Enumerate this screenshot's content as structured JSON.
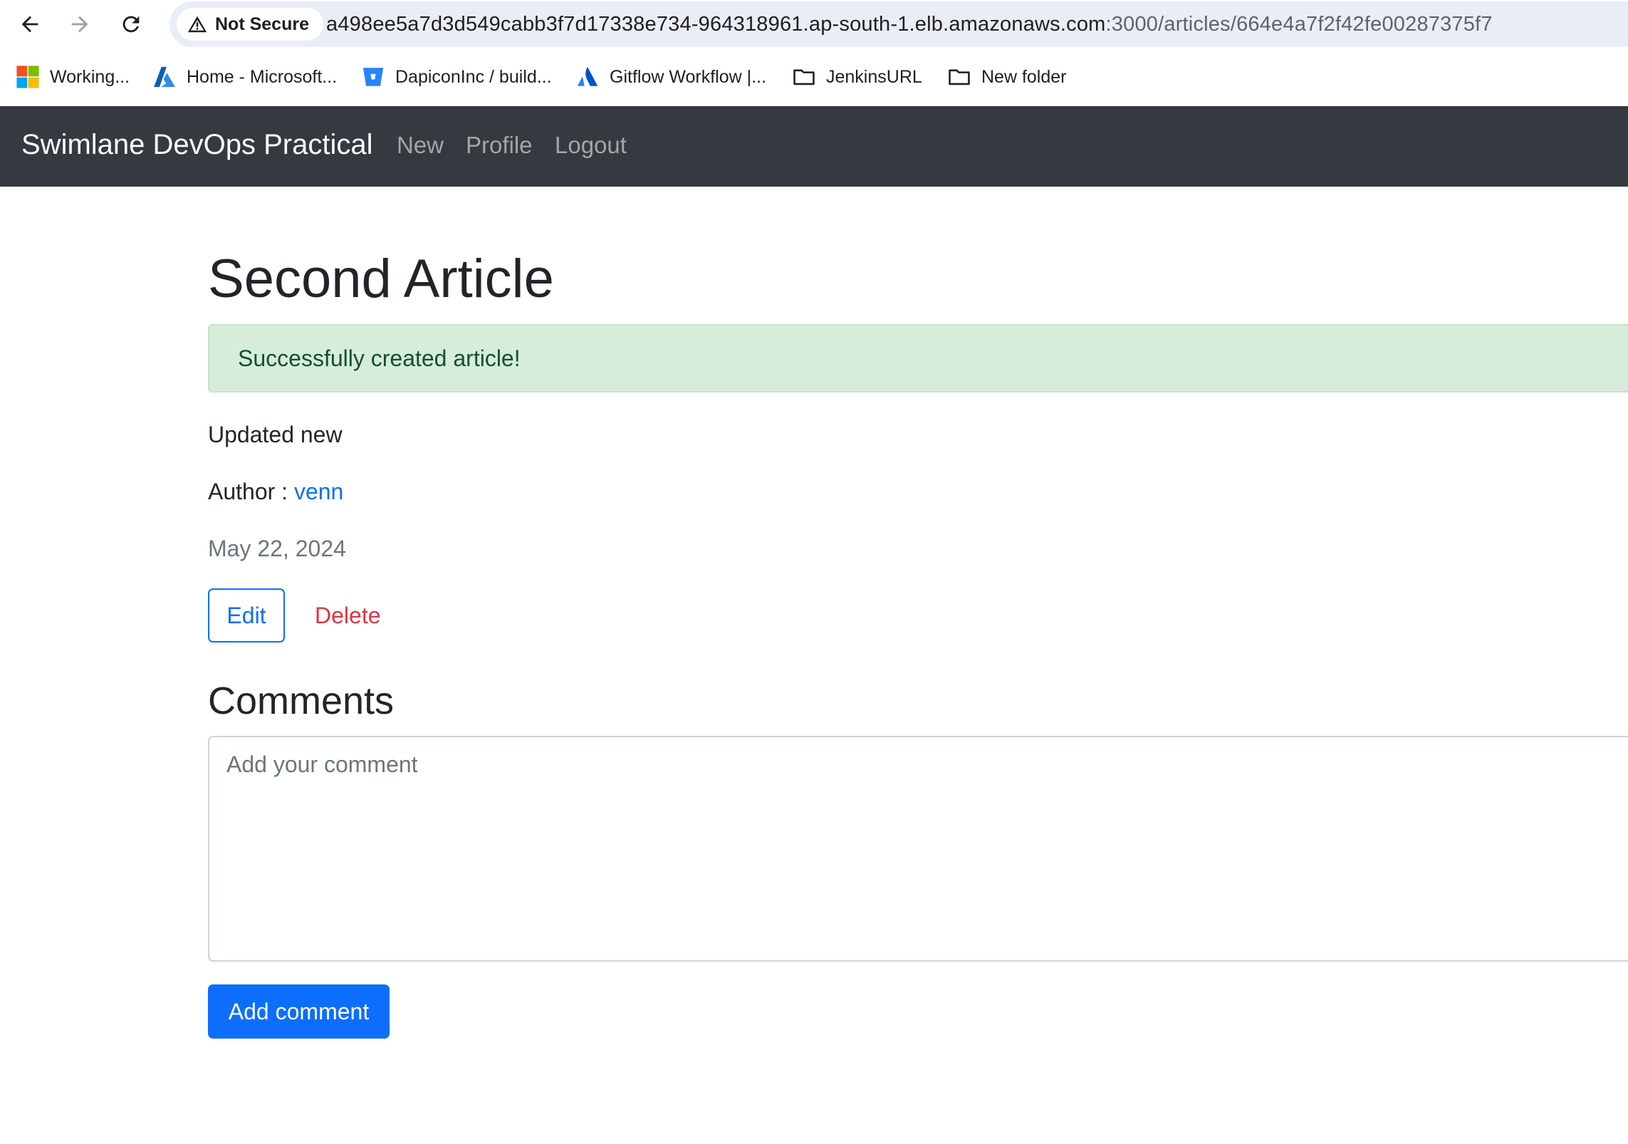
{
  "browser": {
    "security_label": "Not Secure",
    "url_host": "a498ee5a7d3d549cabb3f7d17338e734-964318961.ap-south-1.elb.amazonaws.com",
    "url_path": ":3000/articles/664e4a7f2f42fe00287375f7",
    "bookmarks": [
      {
        "label": "Working...",
        "icon": "microsoft-logo-icon"
      },
      {
        "label": "Home - Microsoft...",
        "icon": "azure-logo-icon"
      },
      {
        "label": "DapiconInc / build...",
        "icon": "bitbucket-logo-icon"
      },
      {
        "label": "Gitflow Workflow |...",
        "icon": "atlassian-logo-icon"
      },
      {
        "label": "JenkinsURL",
        "icon": "folder-icon"
      },
      {
        "label": "New folder",
        "icon": "folder-icon"
      }
    ]
  },
  "navbar": {
    "brand": "Swimlane DevOps Practical",
    "links": [
      "New",
      "Profile",
      "Logout"
    ],
    "background": "#343a40"
  },
  "article": {
    "title": "Second Article",
    "flash_message": "Successfully created article!",
    "body": "Updated new",
    "author_label": "Author : ",
    "author_name": "venn",
    "date": "May 22, 2024",
    "edit_label": "Edit",
    "delete_label": "Delete"
  },
  "comments": {
    "heading": "Comments",
    "placeholder": "Add your comment",
    "value": "",
    "submit_label": "Add comment"
  },
  "colors": {
    "primary": "#0d6efd",
    "danger": "#dc3545",
    "success_bg": "#d8ecdb",
    "success_text": "#0f5132",
    "muted": "#6c757d"
  }
}
